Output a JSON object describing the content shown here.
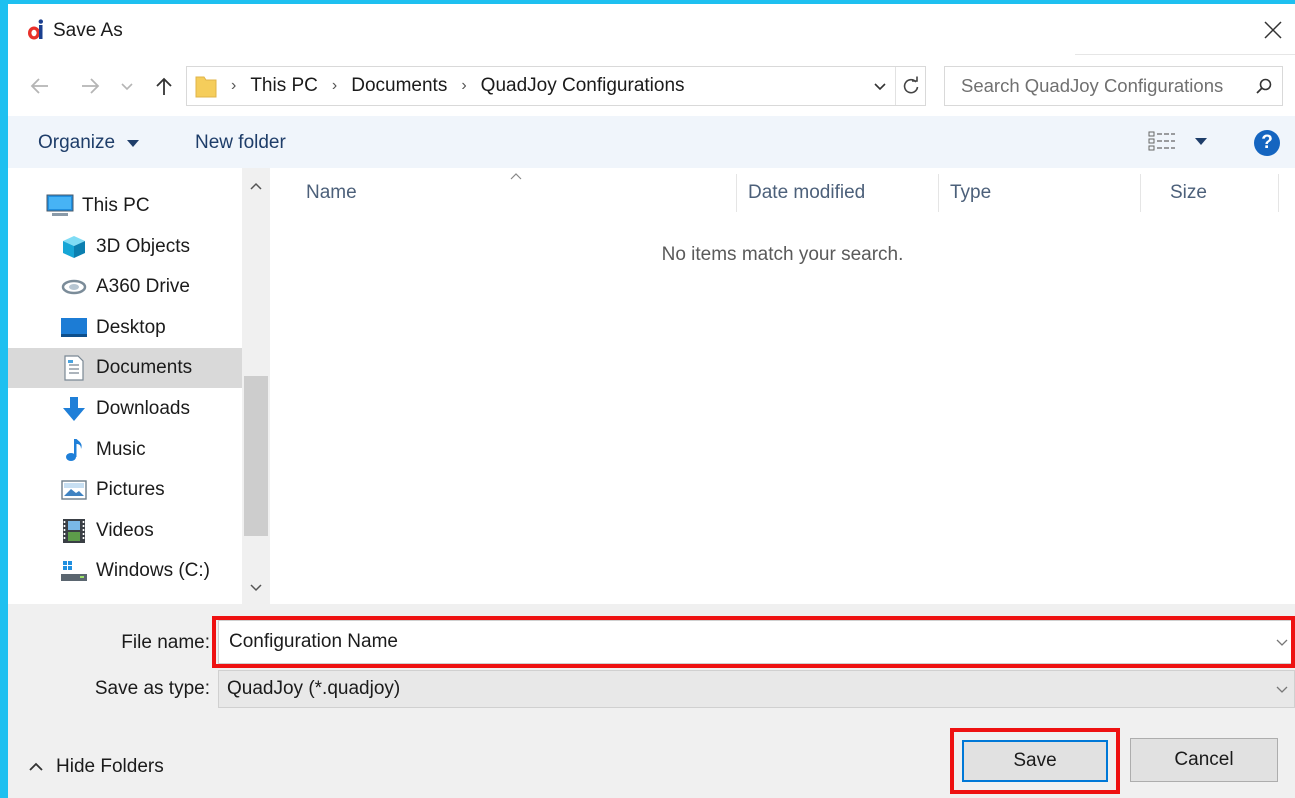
{
  "window": {
    "title": "Save As"
  },
  "nav": {
    "breadcrumbs": [
      "This PC",
      "Documents",
      "QuadJoy Configurations"
    ],
    "search_placeholder": "Search QuadJoy Configurations"
  },
  "command_bar": {
    "organize_label": "Organize",
    "new_folder_label": "New folder"
  },
  "sidebar": {
    "items": [
      {
        "label": "This PC",
        "icon": "computer-icon"
      },
      {
        "label": "3D Objects",
        "icon": "cube-icon"
      },
      {
        "label": "A360 Drive",
        "icon": "cloud-drive-icon"
      },
      {
        "label": "Desktop",
        "icon": "desktop-icon"
      },
      {
        "label": "Documents",
        "icon": "document-icon",
        "selected": true
      },
      {
        "label": "Downloads",
        "icon": "download-arrow-icon"
      },
      {
        "label": "Music",
        "icon": "music-note-icon"
      },
      {
        "label": "Pictures",
        "icon": "picture-icon"
      },
      {
        "label": "Videos",
        "icon": "film-icon"
      },
      {
        "label": "Windows (C:)",
        "icon": "drive-icon"
      }
    ]
  },
  "columns": [
    "Name",
    "Date modified",
    "Type",
    "Size"
  ],
  "empty_message": "No items match your search.",
  "form": {
    "file_name_label": "File name:",
    "file_name_value": "Configuration Name",
    "save_type_label": "Save as type:",
    "save_type_value": "QuadJoy (*.quadjoy)"
  },
  "buttons": {
    "save": "Save",
    "cancel": "Cancel",
    "hide_folders": "Hide Folders"
  },
  "colors": {
    "accent": "#0078d7",
    "highlight": "#ee1111",
    "background": "#1ec0f0"
  }
}
